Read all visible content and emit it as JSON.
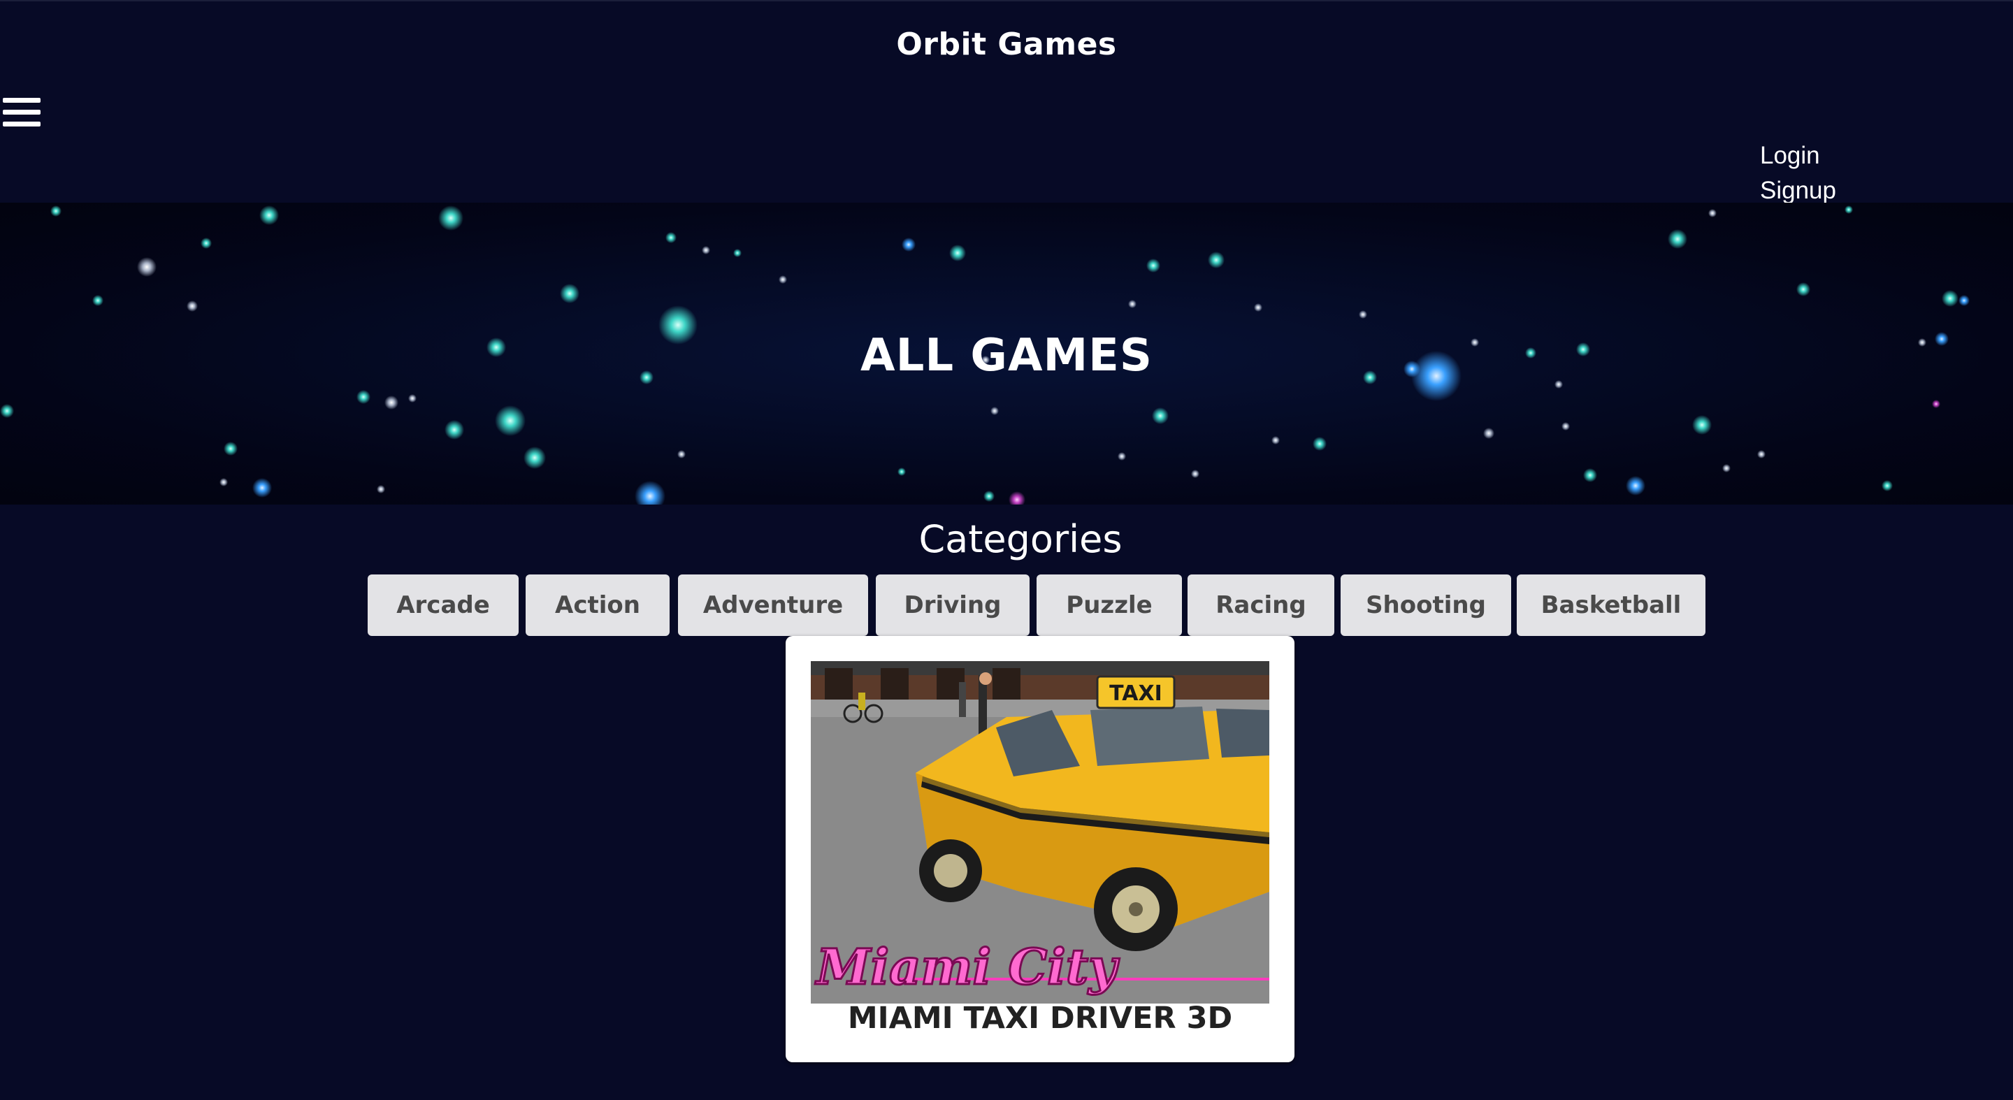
{
  "header": {
    "site_title": "Orbit Games",
    "menu_icon": "hamburger-menu-icon",
    "login_label": "Login",
    "signup_label": "Signup"
  },
  "hero": {
    "title": "ALL GAMES"
  },
  "categories": {
    "heading": "Categories",
    "items": [
      "Arcade",
      "Action",
      "Adventure",
      "Driving",
      "Puzzle",
      "Racing",
      "Shooting",
      "Basketball"
    ]
  },
  "games": [
    {
      "name": "MIAMI TAXI DRIVER 3D",
      "thumbnail_logo": "Miami City",
      "thumbnail_sign": "TAXI"
    }
  ],
  "colors": {
    "background": "#070a26",
    "category_button_bg": "#e3e3e6",
    "category_button_text": "#4a4a4a",
    "card_bg": "#ffffff",
    "taxi_yellow": "#f2b71e",
    "logo_pink": "#ff3bbd"
  }
}
